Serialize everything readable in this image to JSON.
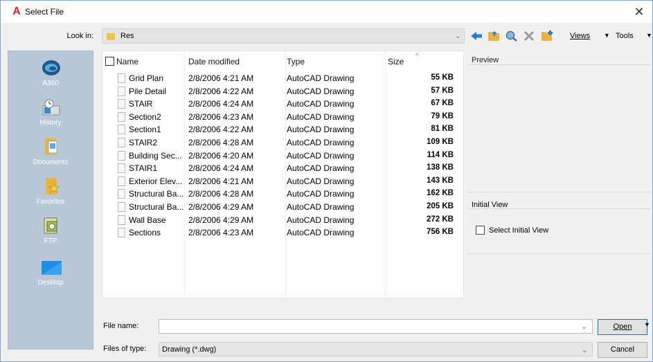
{
  "window": {
    "title": "Select File",
    "close_glyph": "✕",
    "app_icon": "A"
  },
  "lookin": {
    "label": "Look in:",
    "value": "Res"
  },
  "toolbar": {
    "back_icon": "back-arrow-icon",
    "views_label": "Views",
    "tools_label": "Tools"
  },
  "places": [
    {
      "label": "A360",
      "icon": "a360-icon"
    },
    {
      "label": "History",
      "icon": "history-icon"
    },
    {
      "label": "Documents",
      "icon": "documents-icon"
    },
    {
      "label": "Favorites",
      "icon": "favorites-icon"
    },
    {
      "label": "FTP",
      "icon": "ftp-icon"
    },
    {
      "label": "Desktop",
      "icon": "desktop-icon"
    }
  ],
  "columns": {
    "name": "Name",
    "date": "Date modified",
    "type": "Type",
    "size": "Size"
  },
  "files": [
    {
      "name": "Grid Plan",
      "date": "2/8/2006 4:21 AM",
      "type": "AutoCAD Drawing",
      "size": "55 KB"
    },
    {
      "name": "Pile Detail",
      "date": "2/8/2006 4:22 AM",
      "type": "AutoCAD Drawing",
      "size": "57 KB"
    },
    {
      "name": "STAIR",
      "date": "2/8/2006 4:24 AM",
      "type": "AutoCAD Drawing",
      "size": "67 KB"
    },
    {
      "name": "Section2",
      "date": "2/8/2006 4:23 AM",
      "type": "AutoCAD Drawing",
      "size": "79 KB"
    },
    {
      "name": "Section1",
      "date": "2/8/2006 4:22 AM",
      "type": "AutoCAD Drawing",
      "size": "81 KB"
    },
    {
      "name": "STAIR2",
      "date": "2/8/2006 4:28 AM",
      "type": "AutoCAD Drawing",
      "size": "109 KB"
    },
    {
      "name": "Building Sec...",
      "date": "2/8/2006 4:20 AM",
      "type": "AutoCAD Drawing",
      "size": "114 KB"
    },
    {
      "name": "STAIR1",
      "date": "2/8/2006 4:24 AM",
      "type": "AutoCAD Drawing",
      "size": "138 KB"
    },
    {
      "name": "Exterior Elev...",
      "date": "2/8/2006 4:21 AM",
      "type": "AutoCAD Drawing",
      "size": "143 KB"
    },
    {
      "name": "Structural Ba...",
      "date": "2/8/2006 4:28 AM",
      "type": "AutoCAD Drawing",
      "size": "162 KB"
    },
    {
      "name": "Structural Ba...",
      "date": "2/8/2006 4:29 AM",
      "type": "AutoCAD Drawing",
      "size": "205 KB"
    },
    {
      "name": "Wall Base",
      "date": "2/8/2006 4:29 AM",
      "type": "AutoCAD Drawing",
      "size": "272 KB"
    },
    {
      "name": "Sections",
      "date": "2/8/2006 4:23 AM",
      "type": "AutoCAD Drawing",
      "size": "756 KB"
    }
  ],
  "preview": {
    "label": "Preview"
  },
  "initial_view": {
    "label": "Initial View",
    "checkbox_label": "Select Initial View",
    "checked": false
  },
  "filename": {
    "label": "File name:",
    "value": ""
  },
  "filetype": {
    "label": "Files of type:",
    "value": "Drawing (*.dwg)"
  },
  "buttons": {
    "open": "Open",
    "cancel": "Cancel"
  },
  "colors": {
    "places_bg": "#b9c8d8",
    "accent": "#0078d7",
    "app_red": "#d8232a"
  }
}
